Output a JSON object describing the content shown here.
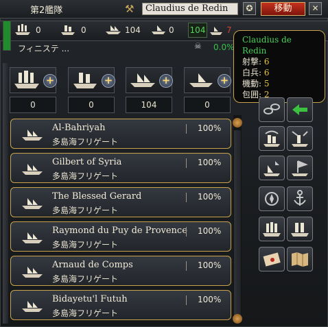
{
  "header": {
    "fleet_title": "第2艦隊",
    "admiral_name": "Claudius de Redin",
    "move_label": "移動",
    "close_label": "✕"
  },
  "stats": {
    "heavy": "0",
    "light": "0",
    "galley": "104",
    "transport": "0",
    "strength_value": "104",
    "red_value": "7",
    "location": "フィニステ ...",
    "morale_pct": "0.0%"
  },
  "tooltip": {
    "name": "Claudius de Redin",
    "rows": [
      {
        "label": "射撃:",
        "value": "6"
      },
      {
        "label": "白兵:",
        "value": "6"
      },
      {
        "label": "機動:",
        "value": "5"
      },
      {
        "label": "包囲:",
        "value": "2"
      }
    ]
  },
  "categories": [
    {
      "icon": "heavy-ship-icon",
      "count": "0"
    },
    {
      "icon": "light-ship-icon",
      "count": "0"
    },
    {
      "icon": "galley-icon",
      "count": "104"
    },
    {
      "icon": "transport-icon",
      "count": "0"
    }
  ],
  "ships": [
    {
      "name": "Al-Bahriyah",
      "strength": "100%",
      "type": "多島海フリゲート"
    },
    {
      "name": "Gilbert of Syria",
      "strength": "100%",
      "type": "多島海フリゲート"
    },
    {
      "name": "The Blessed Gerard",
      "strength": "100%",
      "type": "多島海フリゲート"
    },
    {
      "name": "Raymond du Puy de Provence",
      "strength": "100%",
      "type": "多島海フリゲート"
    },
    {
      "name": "Arnaud de Comps",
      "strength": "100%",
      "type": "多島海フリゲート"
    },
    {
      "name": "Bidayetu'l Futuh",
      "strength": "100%",
      "type": "多島海フリゲート"
    }
  ],
  "colors": {
    "accent_gold": "#c9a44c",
    "move_red": "#c5321e",
    "green": "#4bd25a"
  }
}
